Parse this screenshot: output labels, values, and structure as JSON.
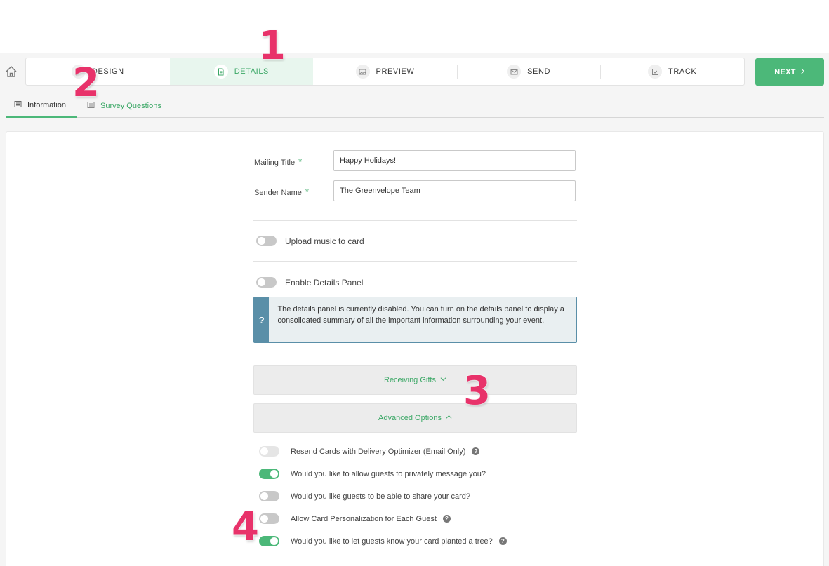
{
  "steps": [
    {
      "label": "DESIGN",
      "icon": "design-icon"
    },
    {
      "label": "DETAILS",
      "icon": "document-icon"
    },
    {
      "label": "PREVIEW",
      "icon": "image-icon"
    },
    {
      "label": "SEND",
      "icon": "envelope-icon"
    },
    {
      "label": "TRACK",
      "icon": "checkbox-icon"
    }
  ],
  "active_step": "DETAILS",
  "next_label": "NEXT",
  "subtabs": [
    {
      "label": "Information",
      "icon": "list-icon"
    },
    {
      "label": "Survey Questions",
      "icon": "list-icon"
    }
  ],
  "form": {
    "mailing_title_label": "Mailing Title",
    "mailing_title_value": "Happy Holidays!",
    "sender_name_label": "Sender Name",
    "sender_name_value": "The Greenvelope Team",
    "required_mark": "*"
  },
  "toggles": {
    "upload_music": "Upload music to card",
    "details_panel": "Enable Details Panel"
  },
  "info_box": {
    "icon_text": "?",
    "text": "The details panel is currently disabled. You can turn on the details panel to display a consolidated summary of all the important information surrounding your event."
  },
  "accordions": {
    "receiving_gifts": "Receiving Gifts",
    "advanced_options": "Advanced Options"
  },
  "options": [
    {
      "label": "Resend Cards with Delivery Optimizer (Email Only)",
      "on": false,
      "help": true
    },
    {
      "label": "Would you like to allow guests to privately message you?",
      "on": true,
      "help": false
    },
    {
      "label": "Would you like guests to be able to share your card?",
      "on": false,
      "help": false
    },
    {
      "label": "Allow Card Personalization for Each Guest",
      "on": false,
      "help": true
    },
    {
      "label": "Would you like to let guests know your card planted a tree?",
      "on": true,
      "help": true
    }
  ],
  "help_icon_text": "?",
  "annotations": [
    "1",
    "2",
    "3",
    "4"
  ],
  "colors": {
    "accent": "#4cb879",
    "accent_text": "#3aa765",
    "active_step_bg": "#e8f6ee",
    "info_box": "#5a8fa8",
    "annotation": "#e8326a"
  }
}
